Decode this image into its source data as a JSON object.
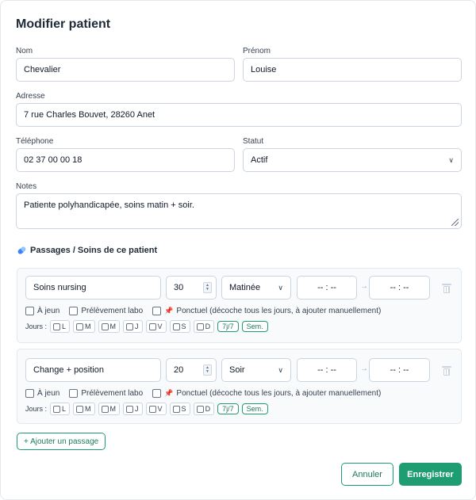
{
  "modal": {
    "title": "Modifier patient"
  },
  "form": {
    "nom_label": "Nom",
    "nom_value": "Chevalier",
    "prenom_label": "Prénom",
    "prenom_value": "Louise",
    "adresse_label": "Adresse",
    "adresse_value": "7 rue Charles Bouvet, 28260 Anet",
    "telephone_label": "Téléphone",
    "telephone_value": "02 37 00 00 18",
    "statut_label": "Statut",
    "statut_value": "Actif",
    "notes_label": "Notes",
    "notes_value": "Patiente polyhandicapée, soins matin + soir."
  },
  "passages": {
    "title": "Passages / Soins de ce patient",
    "items": [
      {
        "name": "Soins nursing",
        "duration": "30",
        "period": "Matinée",
        "start": "-- : --",
        "end": "-- : --",
        "a_jeun": "À jeun",
        "prelevement": "Prélèvement labo",
        "ponctuel": "Ponctuel (décoche tous les jours, à ajouter manuellement)",
        "jours_label": "Jours :",
        "days": [
          "L",
          "M",
          "M",
          "J",
          "V",
          "S",
          "D"
        ],
        "tag_all": "7j/7",
        "tag_week": "Sem."
      },
      {
        "name": "Change + position",
        "duration": "20",
        "period": "Soir",
        "start": "-- : --",
        "end": "-- : --",
        "a_jeun": "À jeun",
        "prelevement": "Prélèvement labo",
        "ponctuel": "Ponctuel (décoche tous les jours, à ajouter manuellement)",
        "jours_label": "Jours :",
        "days": [
          "L",
          "M",
          "M",
          "J",
          "V",
          "S",
          "D"
        ],
        "tag_all": "7j/7",
        "tag_week": "Sem."
      }
    ],
    "add_label": "+ Ajouter un passage"
  },
  "actions": {
    "cancel_label": "Annuler",
    "save_label": "Enregistrer"
  },
  "colors": {
    "accent": "#1f9d72",
    "pin": "#dc2626"
  },
  "icons": {
    "section": "pill-icon",
    "ponctuel": "pin-icon",
    "delete": "trash-icon",
    "select": "chevron-down-icon",
    "duration": "spinner-icon"
  }
}
